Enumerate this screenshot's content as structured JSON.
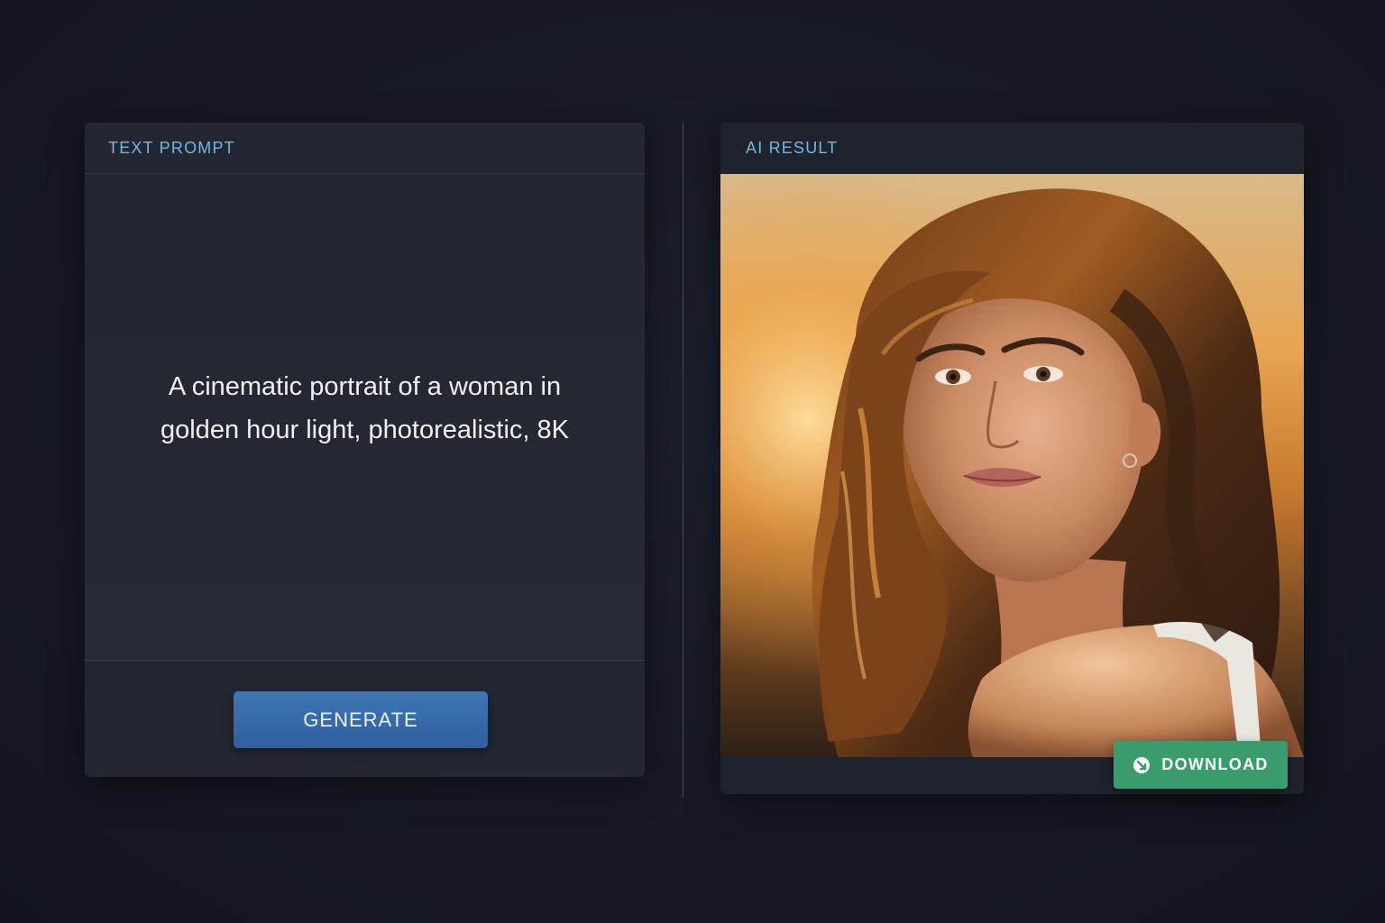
{
  "prompt_panel": {
    "title": "TEXT PROMPT",
    "prompt_text": "A cinematic portrait of a woman in golden hour light, photorealistic, 8K",
    "generate_label": "GENERATE"
  },
  "result_panel": {
    "title": "AI RESULT",
    "download_label": "DOWNLOAD"
  },
  "colors": {
    "background": "#161922",
    "panel": "#232732",
    "accent_title": "#6fb9e3",
    "generate_button": "#3a6eae",
    "download_button": "#3a9c6c"
  },
  "icons": {
    "download": "download-icon"
  }
}
